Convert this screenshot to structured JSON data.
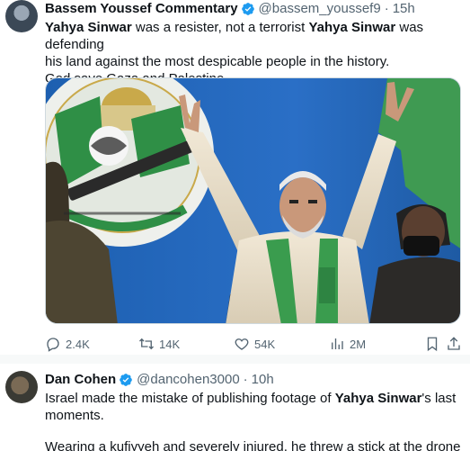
{
  "tweets": [
    {
      "author": "Bassem Youssef Commentary",
      "handle": "@bassem_youssef9",
      "time": "15h",
      "body_lines": [
        [
          {
            "t": "Yahya Sinwar",
            "b": true
          },
          {
            "t": " was a resister, not a terrorist ",
            "b": false
          },
          {
            "t": "Yahya Sinwar",
            "b": true
          },
          {
            "t": " was defending",
            "b": false
          }
        ],
        [
          {
            "t": "his land against the most despicable people in the history.",
            "b": false
          }
        ],
        [
          {
            "t": "God save Gaza and Palestine.",
            "b": false
          }
        ]
      ],
      "stats": {
        "replies": "2.4K",
        "retweets": "14K",
        "likes": "54K",
        "views": "2M"
      }
    },
    {
      "author": "Dan Cohen",
      "handle": "@dancohen3000",
      "time": "10h",
      "body_lines": [
        [
          {
            "t": "Israel made the mistake of publishing footage of ",
            "b": false
          },
          {
            "t": "Yahya Sinwar",
            "b": true
          },
          {
            "t": "'s last",
            "b": false
          }
        ],
        [
          {
            "t": "moments.",
            "b": false
          }
        ]
      ],
      "body_cut_line": "Wearing a kufiyyeh and severely injured, he threw a stick at the drone"
    }
  ],
  "separator": "·",
  "colors": {
    "verified": "#1d9bf0",
    "text": "#0f1419",
    "muted": "#536471",
    "border": "#cfd9de"
  },
  "icons": [
    "verified-icon",
    "reply-icon",
    "retweet-icon",
    "like-icon",
    "views-icon",
    "bookmark-icon",
    "share-icon"
  ]
}
